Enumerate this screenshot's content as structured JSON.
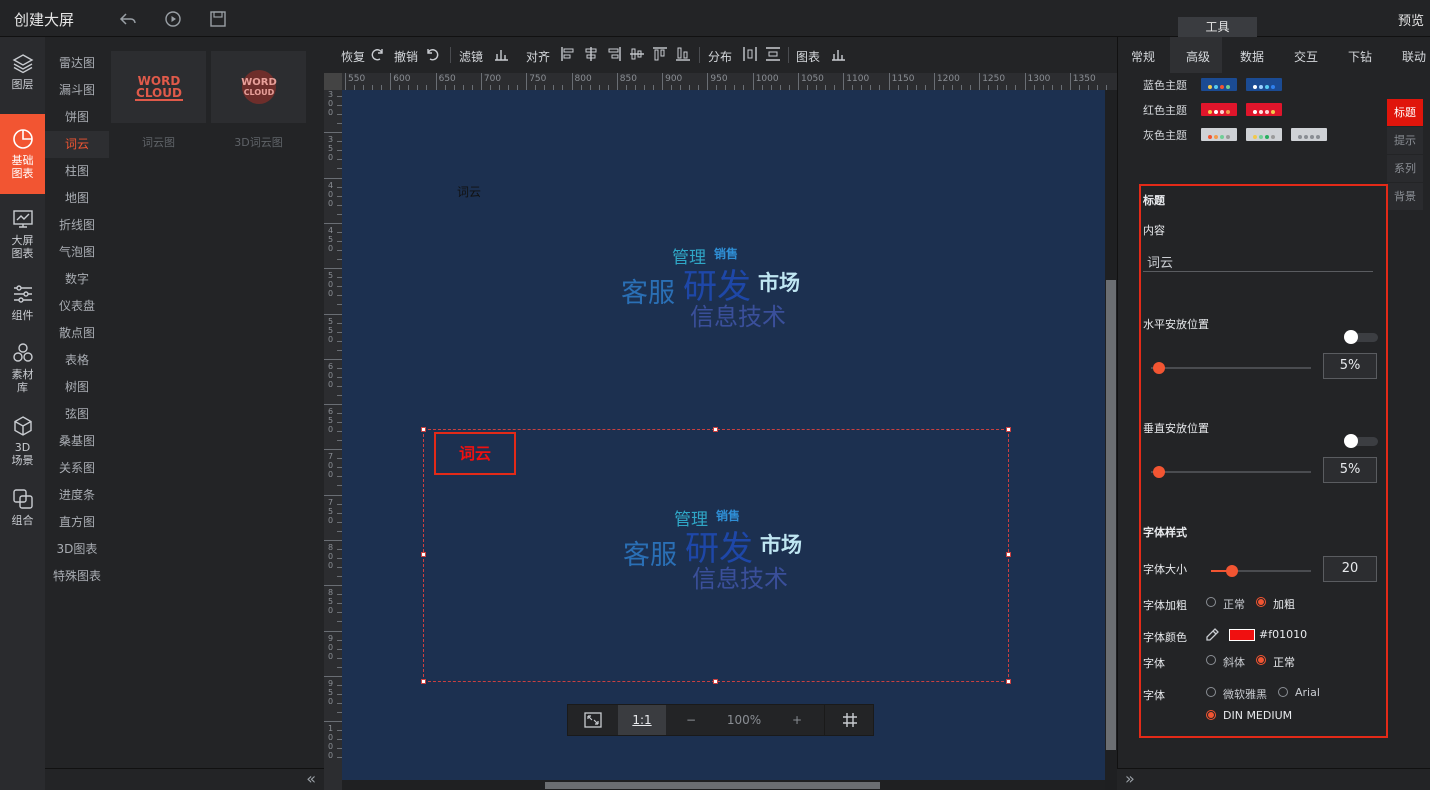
{
  "app": {
    "title": "创建大屏",
    "preview": "预览",
    "tools_tab": "工具"
  },
  "leftnav": [
    {
      "label": "图层",
      "icon": "layers-icon"
    },
    {
      "label": "基础图表",
      "icon": "pie-chart-icon",
      "active": true
    },
    {
      "label": "大屏图表",
      "icon": "screen-chart-icon"
    },
    {
      "label": "组件",
      "icon": "sliders-icon"
    },
    {
      "label": "素材库",
      "icon": "hexagons-icon"
    },
    {
      "label": "3D场景",
      "icon": "cube-icon"
    },
    {
      "label": "组合",
      "icon": "combine-icon"
    }
  ],
  "categories": [
    "雷达图",
    "漏斗图",
    "饼图",
    "词云",
    "柱图",
    "地图",
    "折线图",
    "气泡图",
    "数字",
    "仪表盘",
    "散点图",
    "表格",
    "树图",
    "弦图",
    "桑基图",
    "关系图",
    "进度条",
    "直方图",
    "3D图表",
    "特殊图表"
  ],
  "active_category": "词云",
  "thumbnails": [
    {
      "label": "词云图",
      "art_line1": "WORD",
      "art_line2": "CLOUD"
    },
    {
      "label": "3D词云图",
      "art_line1": "WORD",
      "art_line2": "CLOUD"
    }
  ],
  "toolbar": {
    "redo": "恢复",
    "undo": "撤销",
    "filter": "滤镜",
    "align": "对齐",
    "distribute": "分布",
    "chart": "图表"
  },
  "ruler_h": [
    "550",
    "600",
    "650",
    "700",
    "750",
    "800",
    "850",
    "900",
    "950",
    "1000",
    "1050",
    "1100",
    "1150",
    "1200",
    "1250",
    "1300",
    "1350"
  ],
  "ruler_v": [
    "300",
    "350",
    "400",
    "450",
    "500",
    "550",
    "600",
    "650",
    "700",
    "750",
    "800",
    "850",
    "900",
    "950",
    "1000"
  ],
  "canvas": {
    "bg_color": "#1c3050",
    "upper_chart": {
      "title": "词云"
    },
    "selected_chart": {
      "title": "词云"
    },
    "words": [
      {
        "text": "管理",
        "color": "#2fa6c6"
      },
      {
        "text": "销售",
        "color": "#2f8fd6"
      },
      {
        "text": "客服",
        "color": "#2a6fb5"
      },
      {
        "text": "研发",
        "color": "#1e47a8"
      },
      {
        "text": "市场",
        "color": "#bfe6f2"
      },
      {
        "text": "信息技术",
        "color": "#3a4f9a"
      }
    ]
  },
  "zoombar": {
    "ratio": "1:1",
    "minus": "−",
    "zoom": "100%",
    "plus": "+"
  },
  "right_tabs": [
    "常规",
    "高级",
    "数据",
    "交互",
    "下钻",
    "联动"
  ],
  "right_active_tab": "高级",
  "themes": [
    {
      "label": "蓝色主题",
      "swatches": [
        {
          "bg": "#1b4b93",
          "dots": [
            "#f2c94c",
            "#56ccf2",
            "#f25532",
            "#6fcf97"
          ]
        },
        {
          "bg": "#1b4b93",
          "dots": [
            "#ffffff",
            "#9bd0ff",
            "#56ccf2",
            "#2f80ed"
          ]
        }
      ]
    },
    {
      "label": "红色主题",
      "swatches": [
        {
          "bg": "#e0152b",
          "dots": [
            "#f2c94c",
            "#ffffff",
            "#ffd1d1",
            "#f2994a"
          ]
        },
        {
          "bg": "#e0152b",
          "dots": [
            "#ffffff",
            "#ffe0e0",
            "#ffd1d1",
            "#f2c94c"
          ]
        }
      ]
    },
    {
      "label": "灰色主题",
      "swatches": [
        {
          "bg": "#cfd2d6",
          "dots": [
            "#f25532",
            "#f2994a",
            "#6fcf97",
            "#9b9b9b"
          ]
        },
        {
          "bg": "#cfd2d6",
          "dots": [
            "#f2c94c",
            "#6fcf97",
            "#27ae60",
            "#9b9b9b"
          ]
        },
        {
          "bg": "#cfd2d6",
          "dots": [
            "#8a8e94",
            "#8a8e94",
            "#8a8e94",
            "#8a8e94"
          ]
        }
      ]
    }
  ],
  "side_tabs": [
    "标题",
    "提示",
    "系列",
    "背景"
  ],
  "side_active": "标题",
  "settings": {
    "section_title": "标题",
    "content_label": "内容",
    "content_value": "词云",
    "h_pos_label": "水平安放位置",
    "h_pos_value": "5%",
    "h_pos_fraction": 0.05,
    "v_pos_label": "垂直安放位置",
    "v_pos_value": "5%",
    "v_pos_fraction": 0.05,
    "font_style_label": "字体样式",
    "font_size_label": "字体大小",
    "font_size_value": "20",
    "font_bold_label": "字体加粗",
    "bold_opt_normal": "正常",
    "bold_opt_bold": "加粗",
    "font_color_label": "字体颜色",
    "font_color_value": "#f01010",
    "font_italic_label": "字体",
    "italic_opt_italic": "斜体",
    "italic_opt_normal": "正常",
    "font_family_label": "字体",
    "family_opt_1": "微软雅黑",
    "family_opt_2": "Arial",
    "family_opt_3": "DIN MEDIUM"
  }
}
